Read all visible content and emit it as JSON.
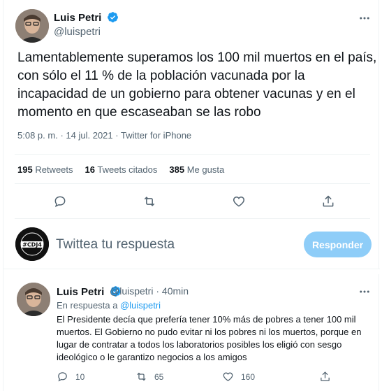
{
  "main_tweet": {
    "author_name": "Luis Petri",
    "handle": "@luispetri",
    "text": "Lamentablemente superamos los 100 mil muertos en el país, con sólo el 11 % de la población vacunada por la incapacidad de un gobierno para obtener vacunas y en el momento en que escaseaban se las robo",
    "time": "5:08 p. m.",
    "date": "14 jul. 2021",
    "separator": "·",
    "source": "Twitter for iPhone",
    "stats": {
      "retweets_count": "195",
      "retweets_label": "Retweets",
      "quotes_count": "16",
      "quotes_label": "Tweets citados",
      "likes_count": "385",
      "likes_label": "Me gusta"
    }
  },
  "compose": {
    "placeholder": "Twittea tu respuesta",
    "reply_button": "Responder",
    "avatar_text": "#CDJ4"
  },
  "reply_tweet": {
    "author_name": "Luis Petri",
    "handle": "@luispetri",
    "separator": "·",
    "time": "40min",
    "replying_prefix": "En respuesta a",
    "replying_to": "@luispetri",
    "text": "El Presidente decía que prefería tener 10% más de pobres a tener 100 mil muertos. El Gobierno no pudo evitar ni los pobres ni los muertos, porque en lugar de contratar a todos los laboratorios posibles los eligió con sesgo ideológico o le garantizo negocios a los amigos",
    "replies_count": "10",
    "retweets_count": "65",
    "likes_count": "160"
  },
  "colors": {
    "accent": "#1d9bf0",
    "reply_button_disabled": "#8ecdf8",
    "secondary_text": "#536471",
    "divider": "#eff3f4"
  },
  "icons": [
    "verified-icon",
    "more-icon",
    "reply-icon",
    "retweet-icon",
    "like-icon",
    "share-icon"
  ]
}
